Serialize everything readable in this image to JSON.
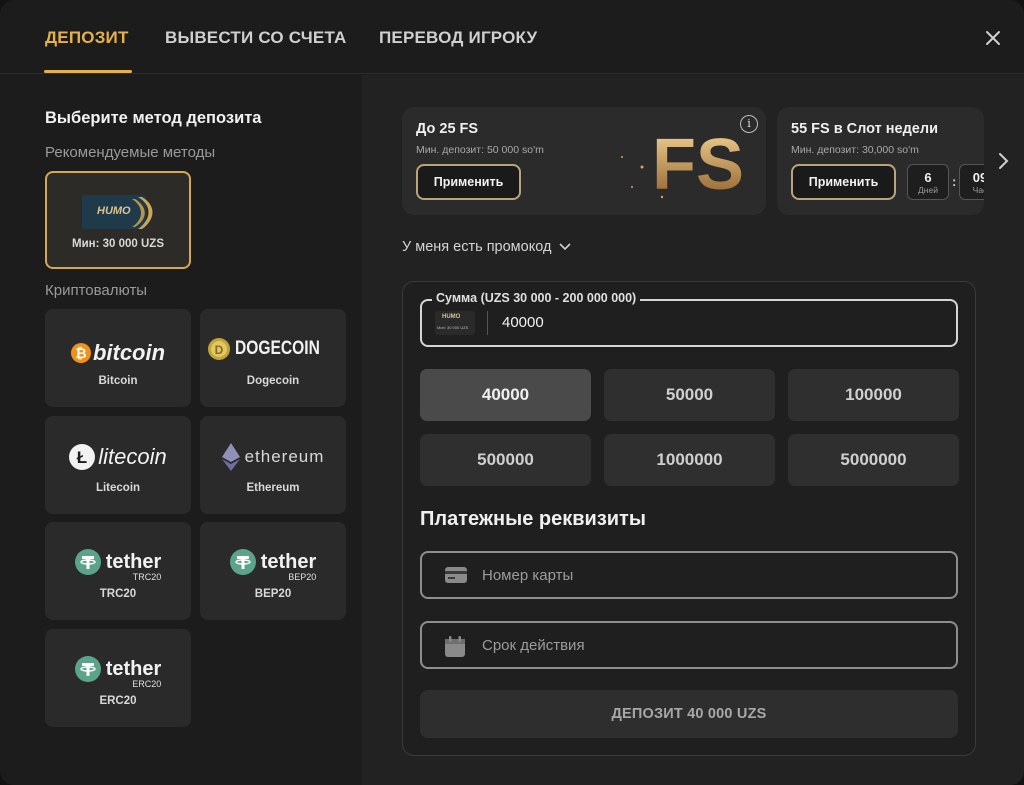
{
  "tabs": [
    {
      "label": "ДЕПОЗИТ",
      "active": true
    },
    {
      "label": "ВЫВЕСТИ СО СЧЕТА",
      "active": false
    },
    {
      "label": "ПЕРЕВОД ИГРОКУ",
      "active": false
    }
  ],
  "left": {
    "title": "Выберите метод депозита",
    "recommended_label": "Рекомендуемые методы",
    "recommended": [
      {
        "logo_text": "HUMO",
        "caption": "Мин: 30 000 UZS",
        "selected": true
      }
    ],
    "crypto_label": "Криптовалюты",
    "crypto": [
      {
        "logo_text": "bitcoin",
        "caption": "Bitcoin",
        "icon": "bitcoin-icon"
      },
      {
        "logo_text": "DOGECOIN",
        "caption": "Dogecoin",
        "icon": "dogecoin-icon"
      },
      {
        "logo_text": "litecoin",
        "caption": "Litecoin",
        "icon": "litecoin-icon"
      },
      {
        "logo_text": "ethereum",
        "caption": "Ethereum",
        "icon": "ethereum-icon"
      },
      {
        "logo_text": "tether",
        "logo_sub": "TRC20",
        "caption": "TRC20",
        "icon": "tether-icon"
      },
      {
        "logo_text": "tether",
        "logo_sub": "BEP20",
        "caption": "BEP20",
        "icon": "tether-icon"
      },
      {
        "logo_text": "tether",
        "logo_sub": "ERC20",
        "caption": "ERC20",
        "icon": "tether-icon"
      }
    ]
  },
  "promos": [
    {
      "title": "До 25 FS",
      "subtitle": "Мин. депозит: 50 000 so'm",
      "button": "Применить",
      "badge": "FS"
    },
    {
      "title": "55 FS в Слот недели",
      "subtitle": "Мин. депозит: 30,000 so'm",
      "button": "Применить",
      "timer_days": "6",
      "timer_days_label": "Дней",
      "timer_sep": ":",
      "timer_hours": "09",
      "timer_hours_label": "Час"
    }
  ],
  "promocode_label": "У меня есть промокод",
  "amount": {
    "legend": "Сумма (UZS 30 000 - 200 000 000)",
    "value": "40000",
    "method_mini_logo": "HUMO",
    "method_mini_caption": "Мин: 30 000 UZS"
  },
  "presets": [
    "40000",
    "50000",
    "100000",
    "500000",
    "1000000",
    "5000000"
  ],
  "active_preset": "40000",
  "payment": {
    "title": "Платежные реквизиты",
    "card_placeholder": "Номер карты",
    "expiry_placeholder": "Срок действия"
  },
  "deposit_button": "ДЕПОЗИТ 40 000 UZS",
  "colors": {
    "accent": "#e6b04a",
    "tether": "#5ba48a",
    "bitcoin": "#f0921a"
  }
}
